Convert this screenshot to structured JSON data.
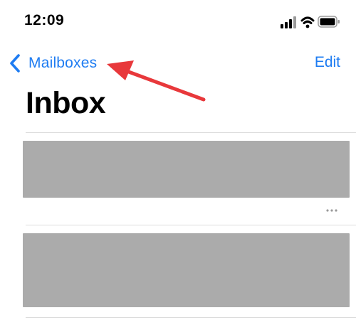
{
  "status_bar": {
    "time": "12:09",
    "icons": [
      "cellular-signal-icon",
      "wifi-icon",
      "battery-icon"
    ]
  },
  "nav": {
    "back_label": "Mailboxes",
    "edit_label": "Edit"
  },
  "page": {
    "title": "Inbox"
  },
  "colors": {
    "accent": "#1e7cf2",
    "annotation_arrow": "#e8383b",
    "redacted_row": "#ababab",
    "divider": "#dcdcdc"
  },
  "annotation": {
    "type": "arrow",
    "points_to": "back-button-mailboxes"
  }
}
